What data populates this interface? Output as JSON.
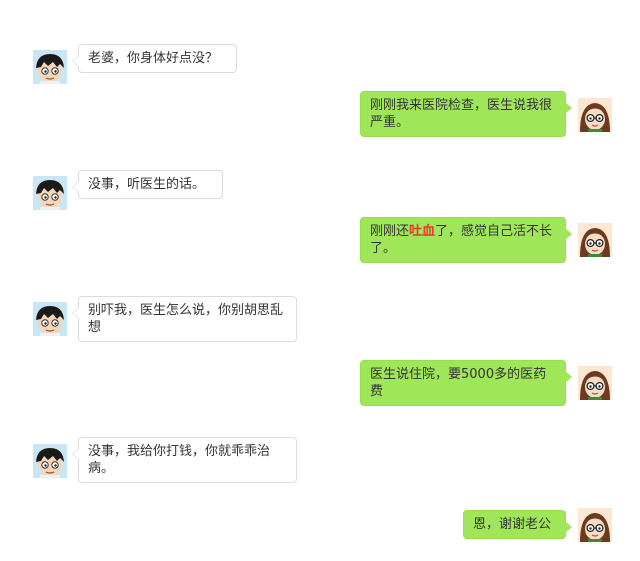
{
  "messages": [
    {
      "sender": "husband",
      "avatar": "husband-avatar-icon",
      "text": "老婆，你身体好点没？"
    },
    {
      "sender": "wife",
      "avatar": "wife-avatar-icon",
      "text": "刚刚我来医院检查，医生说我很严重。"
    },
    {
      "sender": "husband",
      "avatar": "husband-avatar-icon",
      "text": "没事，听医生的话。"
    },
    {
      "sender": "wife",
      "avatar": "wife-avatar-icon",
      "text_before": "刚刚还",
      "highlight": "吐血",
      "text_after": "了，感觉自己活不长了。"
    },
    {
      "sender": "husband",
      "avatar": "husband-avatar-icon",
      "text": "别吓我，医生怎么说，你别胡思乱想"
    },
    {
      "sender": "wife",
      "avatar": "wife-avatar-icon",
      "text": "医生说住院，要5000多的医药费"
    },
    {
      "sender": "husband",
      "avatar": "husband-avatar-icon",
      "text": "没事，我给你打钱，你就乖乖治病。"
    },
    {
      "sender": "wife",
      "avatar": "wife-avatar-icon",
      "text": "恩，谢谢老公"
    }
  ],
  "colors": {
    "sent_bubble": "#9fe658",
    "received_bubble": "#ffffff",
    "highlight_text": "#e8372e"
  }
}
